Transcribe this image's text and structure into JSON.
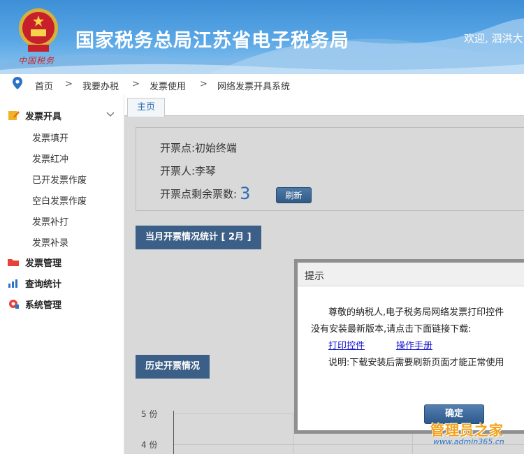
{
  "header": {
    "title": "国家税务总局江苏省电子税务局",
    "welcome": "欢迎, 泗洪大",
    "emblem_caption": "中国税务"
  },
  "breadcrumb": {
    "items": [
      "首页",
      "我要办税",
      "发票使用",
      "网络发票开具系统"
    ],
    "separator": ">"
  },
  "sidebar": {
    "groups": [
      {
        "label": "发票开具",
        "icon": "edit-icon",
        "expanded": true,
        "items": [
          "发票填开",
          "发票红冲",
          "已开发票作废",
          "空白发票作废",
          "发票补打",
          "发票补录"
        ]
      },
      {
        "label": "发票管理",
        "icon": "folder-icon"
      },
      {
        "label": "查询统计",
        "icon": "chart-icon"
      },
      {
        "label": "系统管理",
        "icon": "gear-icon"
      }
    ]
  },
  "tabs": {
    "home": "主页"
  },
  "info": {
    "point_label": "开票点:初始终端",
    "person_label": "开票人:李琴",
    "remaining_label": "开票点剩余票数:",
    "remaining_count": "3",
    "refresh_button": "刷新"
  },
  "sections": {
    "monthly": "当月开票情况统计 [ 2月 ]",
    "history": "历史开票情况"
  },
  "chart": {
    "y_ticks": [
      "5 份",
      "4 份"
    ]
  },
  "dialog": {
    "title": "提示",
    "line1": "尊敬的纳税人,电子税务局网络发票打印控件",
    "line2": "没有安装最新版本,请点击下面链接下载:",
    "link_plugin": "打印控件",
    "link_manual": "操作手册",
    "note": "说明:下载安装后需要刷新页面才能正常使用",
    "ok_button": "确定"
  },
  "watermark": {
    "text": "管理员之家",
    "url": "www.admin365.cn"
  },
  "colors": {
    "header_blue": "#3d8fd6",
    "section_bg": "#3b5f86",
    "link": "#1a1ad0",
    "accent_orange": "#f3a21a"
  }
}
